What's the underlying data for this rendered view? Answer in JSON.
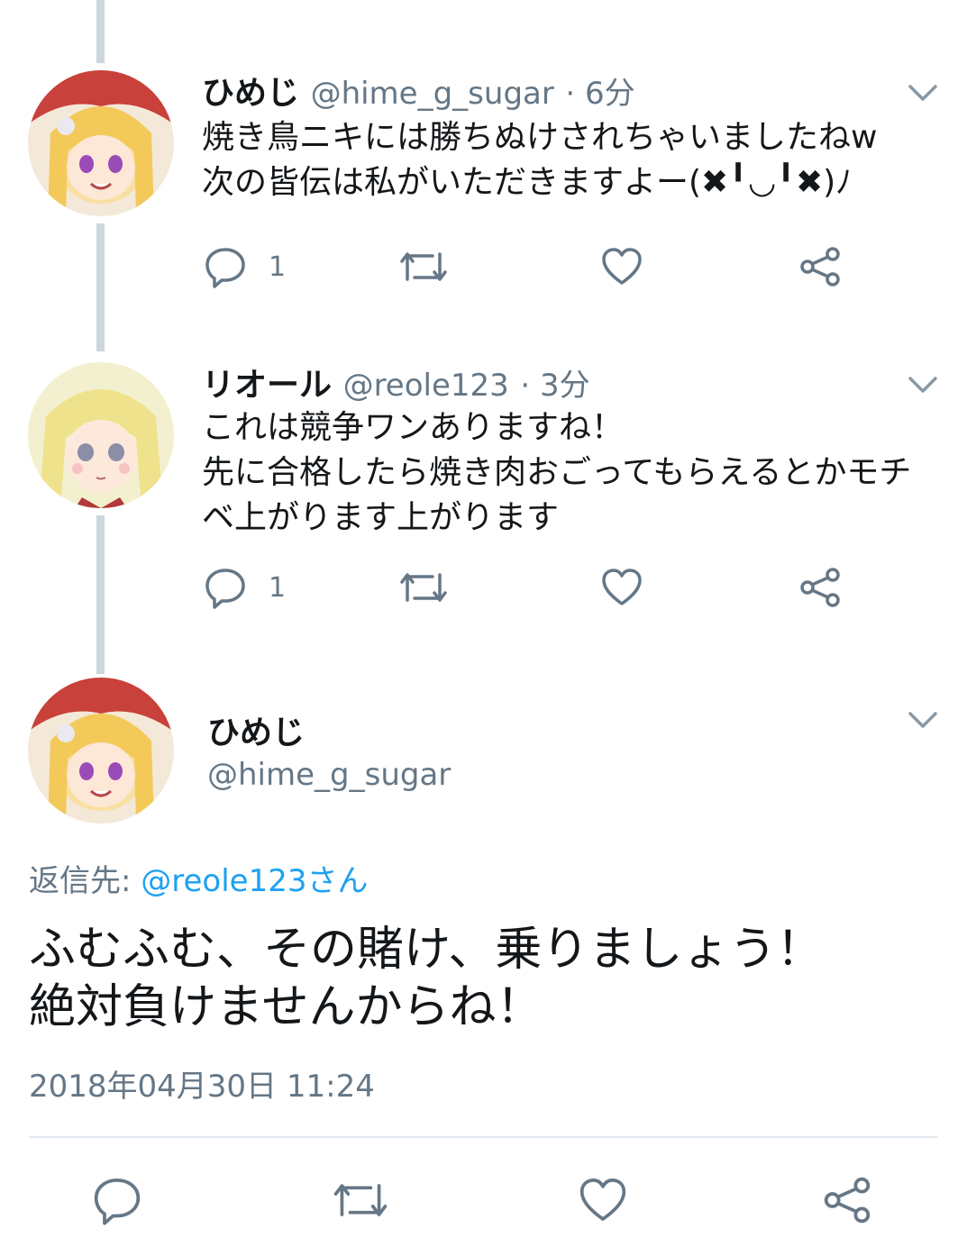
{
  "tweets": [
    {
      "name": "ひめじ",
      "handle": "@hime_g_sugar",
      "time": "· 6分",
      "text": "焼き鳥ニキには勝ちぬけされちゃいましたねw\n次の皆伝は私がいただきますよー(✖╹◡╹✖)ﾉ",
      "reply_count": "1"
    },
    {
      "name": "リオール",
      "handle": "@reole123",
      "time": "· 3分",
      "text": "これは競争ワンありますね！\n先に合格したら焼き肉おごってもらえるとかモチベ上がります上がります",
      "reply_count": "1"
    }
  ],
  "main_tweet": {
    "name": "ひめじ",
    "handle": "@hime_g_sugar",
    "reply_label": "返信先: ",
    "reply_target": "@reole123さん",
    "text": "ふむふむ、その賭け、乗りましょう！\n絶対負けませんからね！",
    "timestamp": "2018年04月30日 11:24"
  },
  "icons": {
    "reply": "reply-icon",
    "retweet": "retweet-icon",
    "like": "heart-icon",
    "share": "share-icon",
    "menu": "chevron-down-icon"
  },
  "colors": {
    "text": "#14171a",
    "muted": "#657786",
    "link": "#1da1f2",
    "thread_line": "#ccd6dd"
  }
}
